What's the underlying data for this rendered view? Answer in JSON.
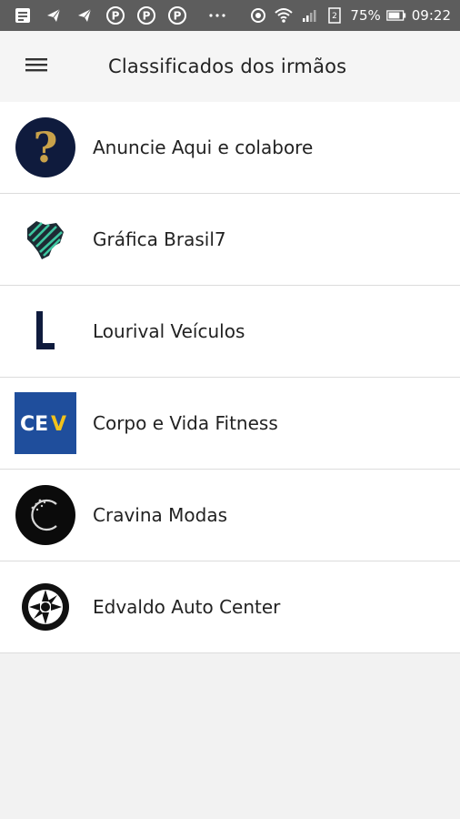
{
  "status_bar": {
    "battery": "75%",
    "time": "09:22",
    "icons": [
      "message-icon",
      "telegram-icon",
      "telegram-icon",
      "pinterest-icon",
      "pinterest-icon",
      "pinterest-icon",
      "more-icon",
      "sync-icon",
      "wifi-icon",
      "signal-icon",
      "sim2-icon",
      "battery-icon"
    ]
  },
  "header": {
    "title": "Classificados dos irmãos",
    "menu_icon": "hamburger-menu-icon"
  },
  "list": {
    "items": [
      {
        "label": "Anuncie Aqui e colabore",
        "icon": "question-mark-logo"
      },
      {
        "label": "Gráfica Brasil7",
        "icon": "brazil-map-logo"
      },
      {
        "label": "Lourival Veículos",
        "icon": "letter-l-logo"
      },
      {
        "label": "Corpo e Vida Fitness",
        "icon": "cev-logo"
      },
      {
        "label": "Cravina Modas",
        "icon": "cravina-logo"
      },
      {
        "label": "Edvaldo Auto Center",
        "icon": "wheel-logo"
      }
    ]
  },
  "colors": {
    "status_bar_bg": "#5d5d5d",
    "header_bg": "#f5f5f5",
    "cev_blue": "#1f4e9c",
    "cev_yellow": "#f2c21b",
    "question_bg": "#0f1b3d",
    "question_fg": "#c9a24a"
  }
}
